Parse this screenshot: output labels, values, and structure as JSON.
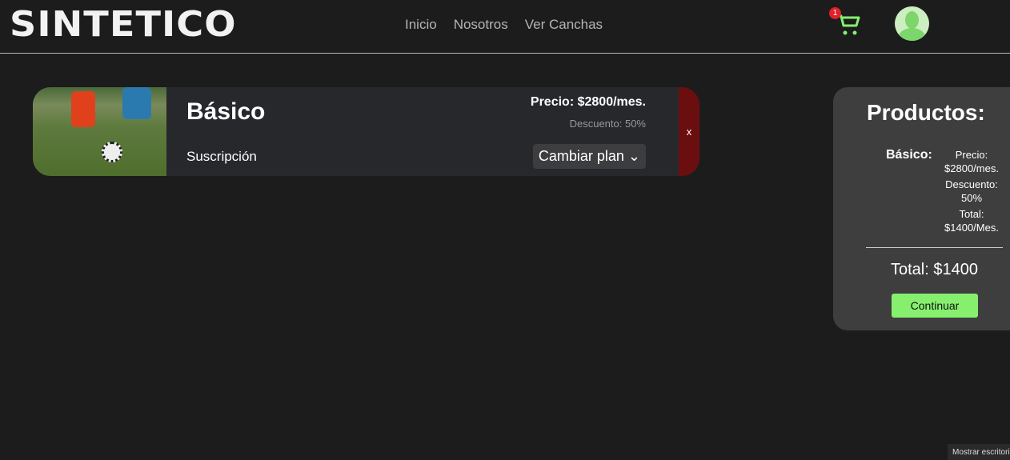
{
  "brand": "SINTETICO",
  "nav": {
    "links": [
      "Inicio",
      "Nosotros",
      "Ver Canchas"
    ],
    "cart_count": "1"
  },
  "colors": {
    "accent": "#86f06e",
    "remove": "#6a0e10",
    "badge": "#e0202a"
  },
  "cart_item": {
    "title": "Básico",
    "subtitle": "Suscripción",
    "price": "Precio: $2800/mes.",
    "discount": "Descuento: 50%",
    "select": "Cambiar plan ⌄",
    "remove": "x"
  },
  "summary": {
    "title": "Productos:",
    "item_name": "Básico:",
    "price_label": "Precio:",
    "price": "$2800/mes.",
    "discount_label": "Descuento:",
    "discount": "50%",
    "total_label": "Total:",
    "item_total": "$1400/Mes.",
    "total": "Total: $1400",
    "continue": "Continuar"
  },
  "tooltip": "Mostrar escritorio"
}
